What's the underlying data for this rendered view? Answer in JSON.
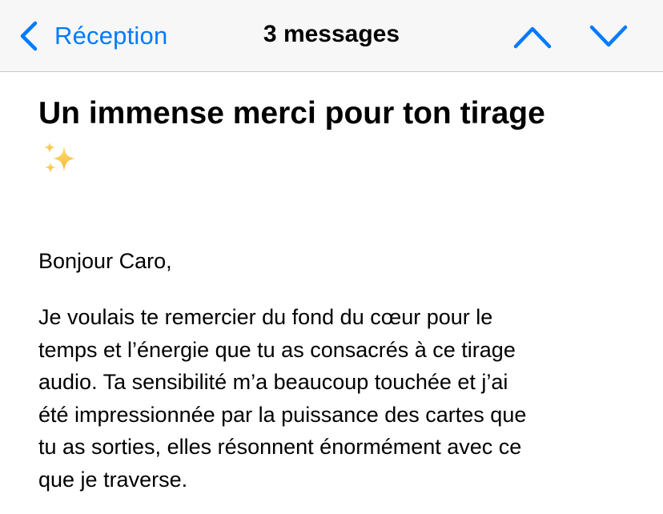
{
  "nav": {
    "back_label": "Réception",
    "title": "3 messages"
  },
  "colors": {
    "accent": "#007aff",
    "nav_background": "#f7f7f7",
    "text": "#000000",
    "sparkle": "#f5c242"
  },
  "icons": {
    "back": "chevron-left-icon",
    "previous": "chevron-up-icon",
    "next": "chevron-down-icon",
    "emoji": "sparkles-icon"
  },
  "email": {
    "subject": "Un immense merci pour ton tirage",
    "greeting": "Bonjour Caro,",
    "body_lines": [
      "Je voulais te remercier du fond du cœur pour le",
      "temps et l’énergie que tu as consacrés à ce tirage",
      "audio. Ta sensibilité m’a beaucoup touchée et j’ai",
      "été impressionnée par la puissance des cartes que",
      "tu as sorties, elles résonnent énormément avec ce",
      "que je traverse."
    ]
  }
}
